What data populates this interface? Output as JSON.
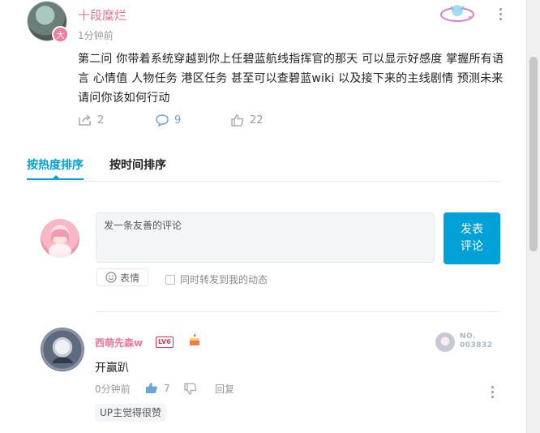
{
  "post": {
    "author": "十段糜烂",
    "avatar_badge": "大",
    "time": "1分钟前",
    "body": "第二问   你带着系统穿越到你上任碧蓝航线指挥官的那天   可以显示好感度  掌握所有语言   心情值   人物任务   港区任务   甚至可以查碧蓝wiki   以及接下来的主线剧情   预测未来   请问你该如何行动",
    "share_count": "2",
    "comment_count": "9",
    "like_count": "22"
  },
  "tabs": [
    {
      "label": "按热度排序",
      "active": true
    },
    {
      "label": "按时间排序",
      "active": false
    }
  ],
  "composer": {
    "placeholder": "发一条友善的评论",
    "submit_label": "发表\n评论",
    "emoji_label": "表情",
    "forward_label": "同时转发到我的动态"
  },
  "comment": {
    "author": "西萌先森w",
    "level": "LV6",
    "fan_label": "NO.",
    "fan_number": "003832",
    "text": "开赢趴",
    "time": "0分钟前",
    "likes": "7",
    "reply_label": "回复",
    "tag": "UP主觉得很赞"
  },
  "colors": {
    "accent": "#00a1d6",
    "author_pink": "#f06f95",
    "like_active": "#6aa5d8"
  },
  "icons": {
    "share": "share-icon",
    "comment": "comment-icon",
    "like": "thumbs-up-icon",
    "dislike": "thumbs-down-icon",
    "emoji": "smiley-icon",
    "more": "more-vertical-icon"
  }
}
